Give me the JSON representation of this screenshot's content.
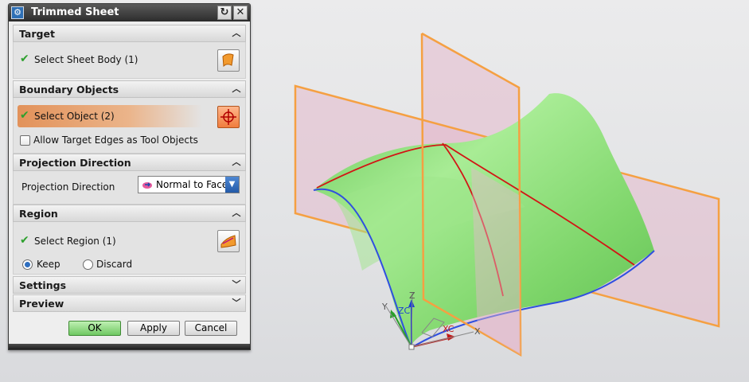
{
  "dialog": {
    "title": "Trimmed Sheet",
    "title_buttons": [
      "↻",
      "✕"
    ],
    "sections": {
      "target": {
        "header": "Target",
        "row_label": "Select Sheet Body (1)"
      },
      "boundary": {
        "header": "Boundary Objects",
        "row_label": "Select Object (2)",
        "checkbox_label": "Allow Target Edges as Tool Objects"
      },
      "projection": {
        "header": "Projection Direction",
        "field_label": "Projection Direction",
        "selected_value": "Normal to Face"
      },
      "region": {
        "header": "Region",
        "row_label": "Select Region (1)",
        "keep_label": "Keep",
        "discard_label": "Discard"
      },
      "settings": {
        "header": "Settings"
      },
      "preview": {
        "header": "Preview"
      }
    },
    "buttons": {
      "ok": "OK",
      "apply": "Apply",
      "cancel": "Cancel"
    }
  },
  "triad": {
    "y_label": "Y",
    "zc_label": "ZC",
    "z_label": "Z",
    "xc_label": "XC",
    "x_label": "X"
  },
  "colors": {
    "surface_green": "#8fdc7a",
    "plane_orange": "#f5a042",
    "plane_fill": "#e4b9cc",
    "boundary_blue": "#2f4fe0",
    "curve_red": "#d21515",
    "highlight_orange": "#e2925a"
  }
}
